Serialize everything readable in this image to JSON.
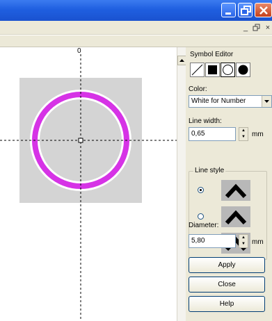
{
  "panel": {
    "title": "Symbol Editor",
    "color_label": "Color:",
    "color_value": "White for Number",
    "line_width_label": "Line width:",
    "line_width_value": "0,65",
    "line_width_unit": "mm",
    "line_style_label": "Line style",
    "diameter_label": "Diameter:",
    "diameter_value": "5,80",
    "diameter_unit": "mm",
    "apply_label": "Apply",
    "close_label": "Close",
    "help_label": "Help"
  },
  "canvas": {
    "ruler_origin": "0",
    "ring_color": "#d633e6",
    "background_square_color": "#d4d4d4"
  },
  "icons": {
    "line_tool": "line-tool-icon",
    "rectangle_tool": "filled-rectangle-icon",
    "circle_tool": "circle-outline-icon",
    "filled_circle_tool": "filled-circle-icon"
  }
}
